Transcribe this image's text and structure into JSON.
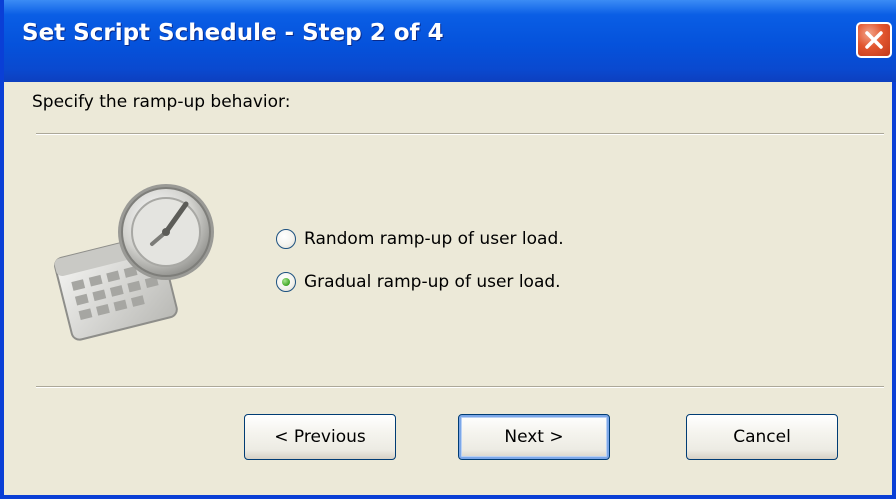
{
  "window": {
    "title": "Set Script Schedule - Step 2 of 4",
    "close_label": "close"
  },
  "prompt": "Specify the ramp-up behavior:",
  "options": [
    {
      "label": "Random ramp-up of user load.",
      "checked": false
    },
    {
      "label": "Gradual ramp-up of user load.",
      "checked": true
    }
  ],
  "buttons": {
    "previous": "< Previous",
    "next": "Next >",
    "cancel": "Cancel"
  },
  "icons": {
    "illustration": "clock-calendar-icon",
    "close": "close-icon"
  },
  "colors": {
    "titlebar": "#0552DB",
    "face": "#ECE9D8",
    "close": "#E2562F",
    "radio_dot": "#3FA524"
  }
}
